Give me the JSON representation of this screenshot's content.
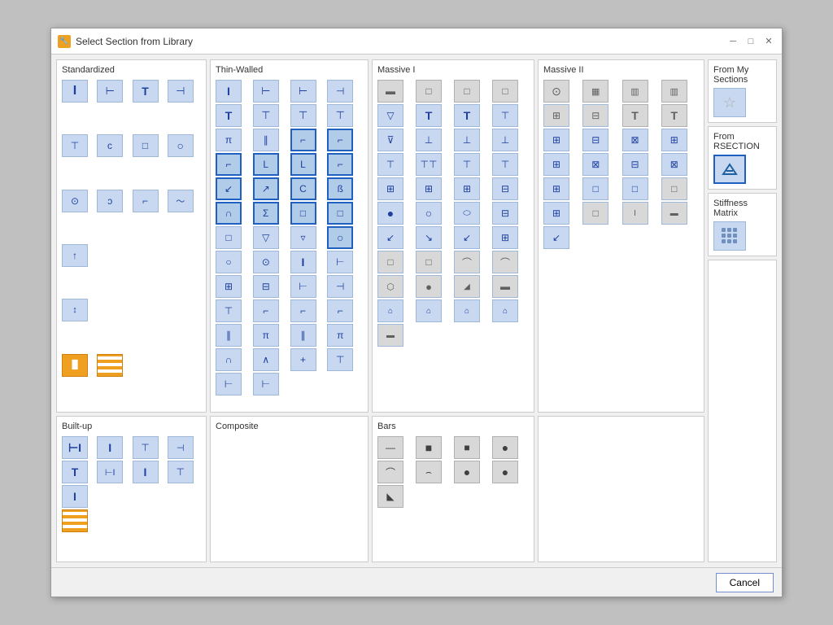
{
  "window": {
    "title": "Select Section from Library",
    "icon": "🔧"
  },
  "sections": {
    "standardized": {
      "label": "Standardized",
      "icons": [
        "I",
        "⊢",
        "T",
        "⊣",
        "⊤",
        "ↄ",
        "□",
        "○",
        "○",
        "ↄ",
        "⌐",
        "～",
        "⊙",
        "↑",
        "↕"
      ]
    },
    "thin_walled": {
      "label": "Thin-Walled"
    },
    "massive_i": {
      "label": "Massive I"
    },
    "massive_ii": {
      "label": "Massive II"
    },
    "built_up": {
      "label": "Built-up"
    },
    "composite": {
      "label": "Composite"
    },
    "bars": {
      "label": "Bars"
    }
  },
  "right_panel": {
    "from_my_sections": "From My Sections",
    "from_rsection": "From RSECTION",
    "stiffness_matrix": "Stiffness Matrix"
  },
  "footer": {
    "cancel_label": "Cancel"
  }
}
